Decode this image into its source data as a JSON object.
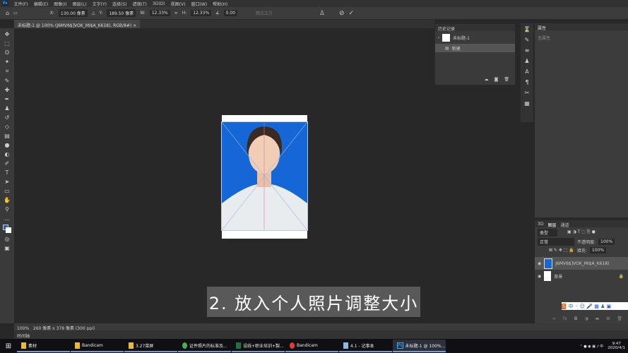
{
  "menu": [
    "文件(F)",
    "编辑(E)",
    "图像(I)",
    "图层(L)",
    "文字(Y)",
    "选择(S)",
    "滤镜(T)",
    "3D(D)",
    "视图(V)",
    "窗口(W)",
    "帮助(H)"
  ],
  "options": {
    "x": "130.00 像素",
    "y": "189.50 像素",
    "w": "12.33%",
    "h": "12.33%",
    "angle": "0.00",
    "interp": "两次立方"
  },
  "doc_tab": "未标题-1 @ 100% (J6MV6$]VOK_MI$A_K618), RGB/8#)",
  "history": {
    "title": "历史记录",
    "snapshot": "未标题-1",
    "items": [
      "新建"
    ]
  },
  "properties": {
    "title": "属性",
    "empty": "无属性"
  },
  "layers": {
    "tabs": [
      "3D",
      "图层",
      "通道"
    ],
    "search": "类型",
    "blend": "正常",
    "opacity_label": "不透明度:",
    "opacity": "100%",
    "fill_label": "填充:",
    "fill": "100%",
    "items": [
      "J6MV6$]VOK_MI$A_K618)",
      "背景"
    ]
  },
  "caption": "2. 放入个人照片调整大小",
  "status": {
    "zoom": "100%",
    "size": "260 像素 x 378 像素 (300 ppi)"
  },
  "timeline": "时间轴",
  "ime": "中",
  "taskbar": {
    "items": [
      "素材",
      "Bandicam",
      "3.27菜屏",
      "证件照片的标准及...",
      "设线+职业培训+製...",
      "Bandicam",
      "4.1 - 记事本",
      "未标题-1 @ 100%..."
    ],
    "time": "9:47",
    "date": "2020/4/1"
  }
}
